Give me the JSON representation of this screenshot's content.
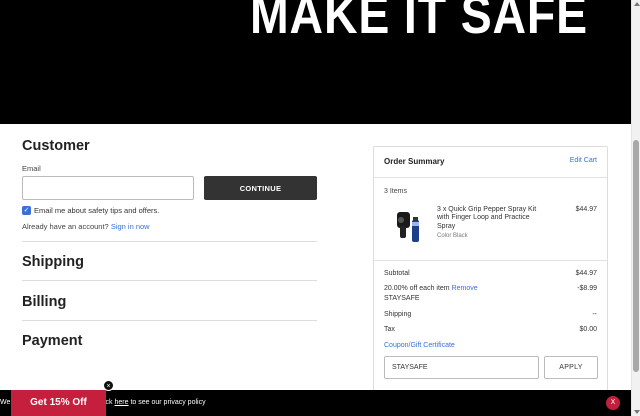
{
  "hero": {
    "title": "MAKE IT SAFE"
  },
  "customer": {
    "title": "Customer",
    "email_label": "Email",
    "email_value": "",
    "continue_label": "CONTINUE",
    "optin_label": "Email me about safety tips and offers.",
    "optin_checked": true,
    "account_prompt": "Already have an account?",
    "signin_label": "Sign in now"
  },
  "sections": {
    "shipping": "Shipping",
    "billing": "Billing",
    "payment": "Payment"
  },
  "order_summary": {
    "title": "Order Summary",
    "edit_cart": "Edit Cart",
    "items_count": "3 Items",
    "product": {
      "name": "3 x Quick Grip Pepper Spray Kit with Finger Loop and Practice Spray",
      "color": "Color Black",
      "price": "$44.97"
    },
    "subtotal_label": "Subtotal",
    "subtotal_value": "$44.97",
    "discount_label": "20.00% off each item",
    "discount_remove": "Remove",
    "discount_code": "STAYSAFE",
    "discount_value": "-$8.99",
    "shipping_label": "Shipping",
    "shipping_value": "--",
    "tax_label": "Tax",
    "tax_value": "$0.00",
    "coupon_link": "Coupon/Gift Certificate",
    "coupon_value": "STAYSAFE",
    "apply_label": "APPLY"
  },
  "cookie_bar": {
    "text_start": "We",
    "text_mid": "ick",
    "link": "here",
    "text_end": "to see our privacy policy",
    "close": "X"
  },
  "promo": {
    "label": "Get 15% Off",
    "close": "×"
  },
  "colors": {
    "accent_link": "#3b6fd8",
    "promo_red": "#c4203e",
    "button_dark": "#333333"
  }
}
